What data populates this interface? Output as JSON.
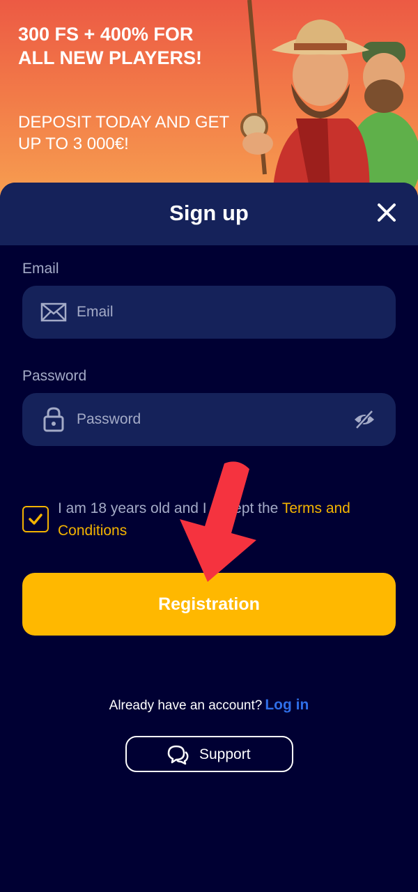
{
  "banner": {
    "title": "300 FS + 400% FOR ALL NEW PLAYERS!",
    "subtitle": "DEPOSIT TODAY AND GET UP TO 3 000€!"
  },
  "modal": {
    "title": "Sign up",
    "close_icon": "close-icon"
  },
  "form": {
    "email": {
      "label": "Email",
      "placeholder": "Email",
      "value": "",
      "icon": "envelope-icon"
    },
    "password": {
      "label": "Password",
      "placeholder": "Password",
      "value": "",
      "icon": "lock-icon",
      "toggle_icon": "eye-off-icon"
    },
    "consent": {
      "checked": true,
      "text": "I am 18 years old and I accept the ",
      "link": "Terms and Conditions"
    },
    "submit_label": "Registration"
  },
  "footer": {
    "account_text": "Already have an account?",
    "login_link": "Log in",
    "support_label": "Support",
    "support_icon": "chat-bubbles-icon"
  },
  "colors": {
    "background": "#000033",
    "panel": "#15225a",
    "accent": "#ffb800",
    "link": "#2f6ee8",
    "annotation_arrow": "#f5333f"
  }
}
